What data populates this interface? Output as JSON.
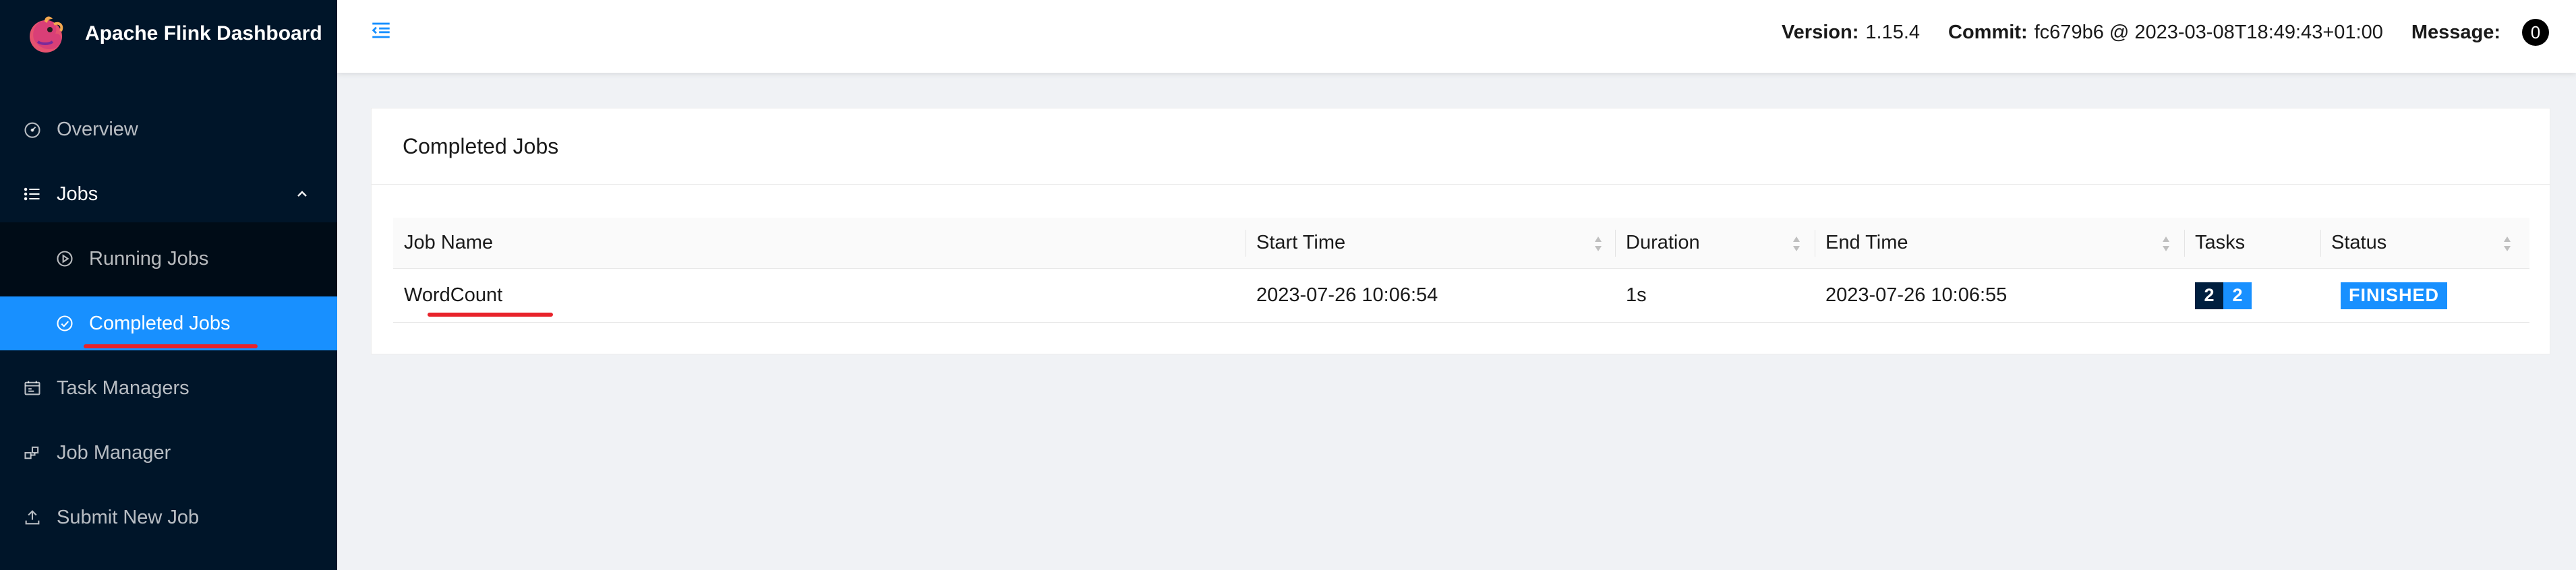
{
  "app": {
    "title": "Apache Flink Dashboard",
    "logo_icon": "flink-squirrel-logo"
  },
  "sidebar": {
    "items": [
      {
        "label": "Overview",
        "icon": "dashboard-icon"
      },
      {
        "label": "Jobs",
        "icon": "list-icon",
        "expanded": true
      },
      {
        "label": "Running Jobs",
        "icon": "play-circle-icon"
      },
      {
        "label": "Completed Jobs",
        "icon": "check-circle-icon",
        "active": true
      },
      {
        "label": "Task Managers",
        "icon": "schedule-icon"
      },
      {
        "label": "Job Manager",
        "icon": "cluster-icon"
      },
      {
        "label": "Submit New Job",
        "icon": "upload-icon"
      }
    ]
  },
  "header": {
    "version_label": "Version:",
    "version_value": "1.15.4",
    "commit_label": "Commit:",
    "commit_value": "fc679b6 @ 2023-03-08T18:49:43+01:00",
    "message_label": "Message:",
    "message_count": "0"
  },
  "card": {
    "title": "Completed Jobs"
  },
  "table": {
    "columns": [
      "Job Name",
      "Start Time",
      "Duration",
      "End Time",
      "Tasks",
      "Status"
    ],
    "rows": [
      {
        "job_name": "WordCount",
        "start_time": "2023-07-26 10:06:54",
        "duration": "1s",
        "end_time": "2023-07-26 10:06:55",
        "tasks_finished": "2",
        "tasks_total": "2",
        "status": "FINISHED"
      }
    ]
  },
  "colors": {
    "sidebar_bg": "#001529",
    "active_bg": "#1890ff",
    "annotation_underline": "#e8232a",
    "status_finished": "#1890ff"
  }
}
